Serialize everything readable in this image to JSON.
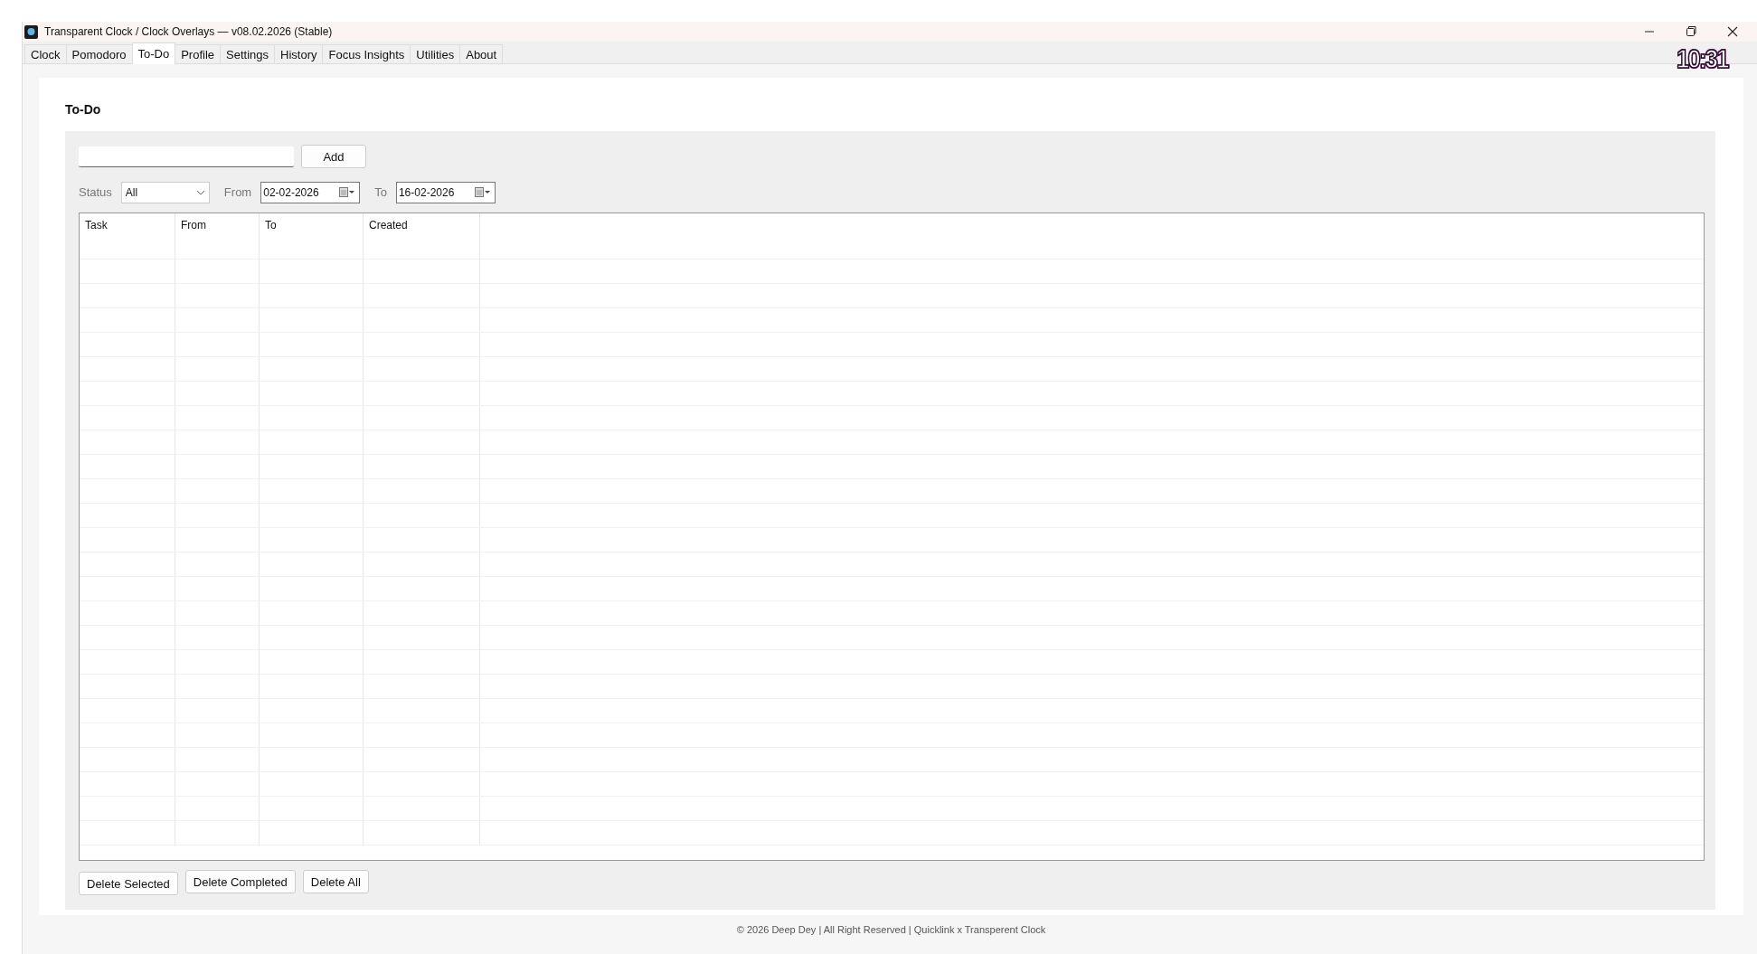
{
  "window": {
    "title": "Transparent Clock / Clock Overlays — v08.02.2026 (Stable)"
  },
  "tabs": [
    {
      "label": "Clock",
      "selected": false
    },
    {
      "label": "Pomodoro",
      "selected": false
    },
    {
      "label": "To-Do",
      "selected": true
    },
    {
      "label": "Profile",
      "selected": false
    },
    {
      "label": "Settings",
      "selected": false
    },
    {
      "label": "History",
      "selected": false
    },
    {
      "label": "Focus Insights",
      "selected": false
    },
    {
      "label": "Utilities",
      "selected": false
    },
    {
      "label": "About",
      "selected": false
    }
  ],
  "clock_overlay": "10:31",
  "heading": "To-Do",
  "add_button": "Add",
  "filters": {
    "status_label": "Status",
    "status_value": "All",
    "from_label": "From",
    "from_value": "02-02-2026",
    "to_label": "To",
    "to_value": "16-02-2026"
  },
  "table": {
    "columns": [
      "Task",
      "From",
      "To",
      "Created"
    ]
  },
  "buttons": [
    "Delete Selected",
    "Delete Completed",
    "Delete All"
  ],
  "footer": "© 2026 Deep Dey | All Right Reserved | Quicklink x Transperent Clock"
}
